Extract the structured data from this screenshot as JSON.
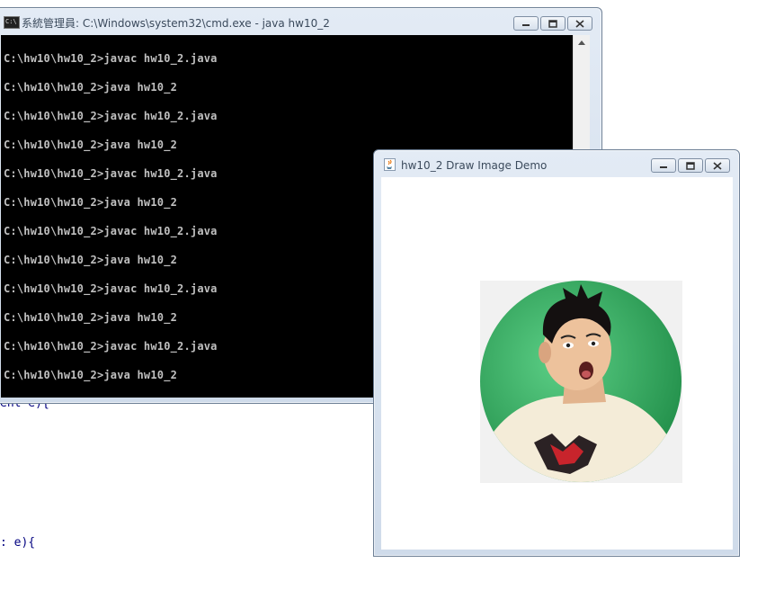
{
  "background_code": {
    "line1": "ent e){",
    "line2": ": e){"
  },
  "cmd_window": {
    "title": "系統管理員: C:\\Windows\\system32\\cmd.exe - java  hw10_2",
    "icon": "cmd-icon",
    "buttons": {
      "minimize": "minimize-icon",
      "maximize": "maximize-icon",
      "close": "close-icon"
    },
    "lines": [
      "C:\\hw10\\hw10_2>javac hw10_2.java",
      "C:\\hw10\\hw10_2>java hw10_2",
      "C:\\hw10\\hw10_2>javac hw10_2.java",
      "C:\\hw10\\hw10_2>java hw10_2",
      "C:\\hw10\\hw10_2>javac hw10_2.java",
      "C:\\hw10\\hw10_2>java hw10_2",
      "C:\\hw10\\hw10_2>javac hw10_2.java",
      "C:\\hw10\\hw10_2>java hw10_2",
      "C:\\hw10\\hw10_2>javac hw10_2.java",
      "C:\\hw10\\hw10_2>java hw10_2",
      "C:\\hw10\\hw10_2>javac hw10_2.java",
      "C:\\hw10\\hw10_2>java hw10_2"
    ],
    "colors": {
      "console_bg": "#000000",
      "console_fg": "#c0c0c0"
    }
  },
  "java_window": {
    "title": "hw10_2 Draw Image Demo",
    "icon": "java-cup-icon",
    "buttons": {
      "minimize": "minimize-icon",
      "maximize": "maximize-icon",
      "close": "close-icon"
    },
    "image": {
      "description_icon": "surprised-man-circle-image",
      "colors": {
        "circle_green": "#2fa45a",
        "box_bg": "#f1f1f1"
      }
    }
  }
}
